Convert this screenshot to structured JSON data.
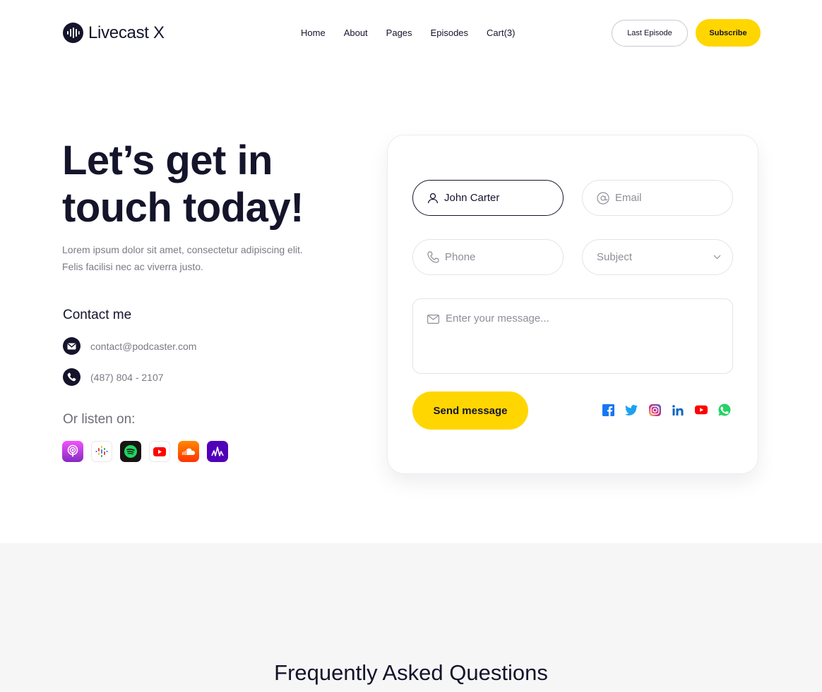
{
  "header": {
    "logo_text": "Livecast X",
    "nav": [
      "Home",
      "About",
      "Pages",
      "Episodes",
      "Cart(3)"
    ],
    "last_episode_label": "Last Episode",
    "subscribe_label": "Subscribe"
  },
  "hero": {
    "title_line1": "Let’s get in",
    "title_line2": "touch today!",
    "description_line1": "Lorem ipsum dolor sit amet, consectetur adipiscing elit.",
    "description_line2": "Felis facilisi nec ac viverra justo."
  },
  "contact": {
    "heading": "Contact me",
    "email": "contact@podcaster.com",
    "phone": "(487) 804 - 2107",
    "listen_label": "Or listen on:",
    "platforms": [
      "apple-podcasts-icon",
      "google-podcasts-icon",
      "spotify-icon",
      "youtube-icon",
      "soundcloud-icon",
      "anchor-icon"
    ]
  },
  "form": {
    "name_value": "John Carter",
    "email_placeholder": "Email",
    "phone_placeholder": "Phone",
    "subject_placeholder": "Subject",
    "message_placeholder": "Enter your message...",
    "send_label": "Send message",
    "socials": [
      "facebook-icon",
      "twitter-icon",
      "instagram-icon",
      "linkedin-icon",
      "youtube-icon",
      "whatsapp-icon"
    ]
  },
  "faq": {
    "title": "Frequently Asked Questions"
  },
  "colors": {
    "accent": "#ffd600",
    "dark": "#14142b",
    "muted": "#7a7a86",
    "section_bg": "#f6f6f7"
  }
}
